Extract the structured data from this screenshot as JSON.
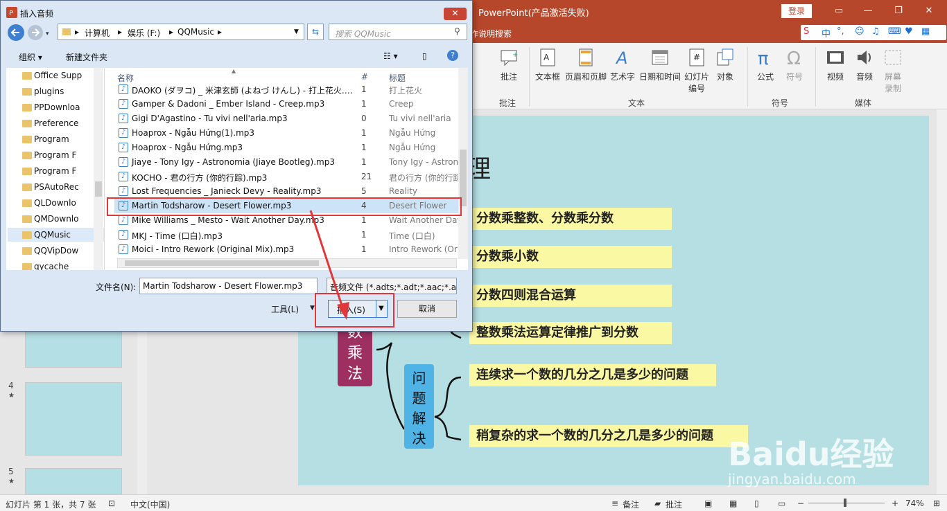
{
  "powerpoint": {
    "title": "PowerPoint(产品激活失败)",
    "login": "登录",
    "tell_me": "作说明搜索",
    "ime": {
      "label1": "中",
      "label2": "°,"
    },
    "ribbon": {
      "comment": "批注",
      "textbox": "文本框",
      "header_footer": "页眉和页脚",
      "wordart": "艺术字",
      "datetime": "日期和时间",
      "slide_number_1": "幻灯片",
      "slide_number_2": "编号",
      "object": "对象",
      "equation": "公式",
      "symbol": "符号",
      "video": "视频",
      "audio": "音频",
      "screen_1": "屏幕",
      "screen_2": "录制",
      "group_comments": "批注",
      "group_text": "文本",
      "group_symbols": "符号",
      "group_media": "媒体"
    },
    "slide": {
      "title_fragment": "理",
      "items": [
        "分数乘整数、分数乘分数",
        "分数乘小数",
        "分数四则混合运算",
        "整数乘法运算定律推广到分数",
        "连续求一个数的几分之几是多少的问题",
        "稍复杂的求一个数的几分之几是多少的问题"
      ],
      "main_box": [
        "数",
        "乘",
        "法"
      ],
      "problem_box": [
        "问",
        "题",
        "解",
        "决"
      ]
    },
    "thumbs": {
      "n4": "4",
      "n5": "5",
      "star": "★"
    },
    "status": {
      "slide_info": "幻灯片 第 1 张，共 7 张",
      "language": "中文(中国)",
      "notes": "备注",
      "comments": "批注",
      "zoom": "74%"
    },
    "watermark": {
      "logo": "Baidu经验",
      "url": "jingyan.baidu.com"
    }
  },
  "dialog": {
    "title": "插入音频",
    "breadcrumb": [
      "计算机",
      "娱乐 (F:)",
      "QQMusic"
    ],
    "search_placeholder": "搜索 QQMusic",
    "organize": "组织 ▾",
    "new_folder": "新建文件夹",
    "tree": [
      "Office Supp",
      "plugins",
      "PPDownloa",
      "Preference",
      "Program",
      "Program F",
      "Program F",
      "PSAutoRec",
      "QLDownlo",
      "QMDownlo",
      "QQMusic",
      "QQVipDow",
      "qycache"
    ],
    "columns": {
      "name": "名称",
      "num": "#",
      "title": "标题"
    },
    "files": [
      {
        "name": "DAOKO (ダヲコ) _ 米津玄師 (よねづ けんし) - 打上花火.…",
        "num": "1",
        "title": "打上花火"
      },
      {
        "name": "Gamper & Dadoni _ Ember Island - Creep.mp3",
        "num": "1",
        "title": "Creep"
      },
      {
        "name": "Gigi D'Agastino - Tu vivi nell'aria.mp3",
        "num": "0",
        "title": "Tu vivi nell'aria"
      },
      {
        "name": "Hoaprox - Ngẫu Hứng(1).mp3",
        "num": "1",
        "title": "Ngẫu Hứng"
      },
      {
        "name": "Hoaprox - Ngẫu Hứng.mp3",
        "num": "1",
        "title": "Ngẫu Hứng"
      },
      {
        "name": "Jiaye - Tony Igy - Astronomia (Jiaye Bootleg).mp3",
        "num": "1",
        "title": "Tony Igy - Astron"
      },
      {
        "name": "KOCHO - 君の行方 (你的行踪).mp3",
        "num": "21",
        "title": "君の行方 (你的行踪"
      },
      {
        "name": "Lost Frequencies _ Janieck Devy - Reality.mp3",
        "num": "5",
        "title": "Reality"
      },
      {
        "name": "Martin Todsharow - Desert Flower.mp3",
        "num": "4",
        "title": "Desert Flower"
      },
      {
        "name": "Mike Williams _ Mesto - Wait Another Day.mp3",
        "num": "1",
        "title": "Wait Another Day"
      },
      {
        "name": "MKJ - Time (口白).mp3",
        "num": "1",
        "title": "Time (口白)"
      },
      {
        "name": "Moici - Intro Rework (Original Mix).mp3",
        "num": "1",
        "title": "Intro Rework (Or"
      }
    ],
    "filename_label": "文件名(N):",
    "filename_value": "Martin Todsharow - Desert Flower.mp3",
    "filetype_value": "音频文件 (*.adts;*.adt;*.aac;*.a",
    "tools": "工具(L)",
    "insert": "插入(S)",
    "cancel": "取消",
    "colors": {
      "accent": "#b7472a",
      "highlight": "#e0373a"
    }
  }
}
